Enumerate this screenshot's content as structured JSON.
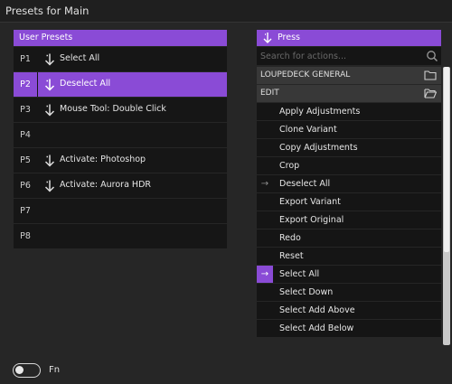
{
  "window": {
    "title": "Presets for Main"
  },
  "presets": {
    "header": "User Presets",
    "rows": [
      {
        "id": "P1",
        "label": "Select All",
        "has_action": true,
        "active": false
      },
      {
        "id": "P2",
        "label": "Deselect All",
        "has_action": true,
        "active": true
      },
      {
        "id": "P3",
        "label": "Mouse Tool: Double Click",
        "has_action": true,
        "active": false
      },
      {
        "id": "P4",
        "label": "",
        "has_action": false,
        "active": false
      },
      {
        "id": "P5",
        "label": "Activate: Photoshop",
        "has_action": true,
        "active": false
      },
      {
        "id": "P6",
        "label": "Activate: Aurora HDR",
        "has_action": true,
        "active": false
      },
      {
        "id": "P7",
        "label": "",
        "has_action": false,
        "active": false
      },
      {
        "id": "P8",
        "label": "",
        "has_action": false,
        "active": false
      }
    ]
  },
  "actions_panel": {
    "header": "Press",
    "search_placeholder": "Search for actions...",
    "groups": [
      {
        "label": "LOUPEDECK GENERAL",
        "icon": "folder-icon"
      },
      {
        "label": "EDIT",
        "icon": "folder-open-icon"
      }
    ],
    "items": [
      {
        "label": "Apply Adjustments",
        "mark": ""
      },
      {
        "label": "Clone Variant",
        "mark": ""
      },
      {
        "label": "Copy Adjustments",
        "mark": ""
      },
      {
        "label": "Crop",
        "mark": ""
      },
      {
        "label": "Deselect All",
        "mark": "→"
      },
      {
        "label": "Export Variant",
        "mark": ""
      },
      {
        "label": "Export Original",
        "mark": ""
      },
      {
        "label": "Redo",
        "mark": ""
      },
      {
        "label": "Reset",
        "mark": ""
      },
      {
        "label": "Select All",
        "mark": "→",
        "selected": true
      },
      {
        "label": "Select Down",
        "mark": ""
      },
      {
        "label": "Select Add Above",
        "mark": ""
      },
      {
        "label": "Select Add Below",
        "mark": ""
      }
    ]
  },
  "footer": {
    "fn_label": "Fn",
    "fn_toggle_on": false
  },
  "colors": {
    "accent": "#8a4bd6",
    "background": "#262626",
    "row": "#161616"
  }
}
